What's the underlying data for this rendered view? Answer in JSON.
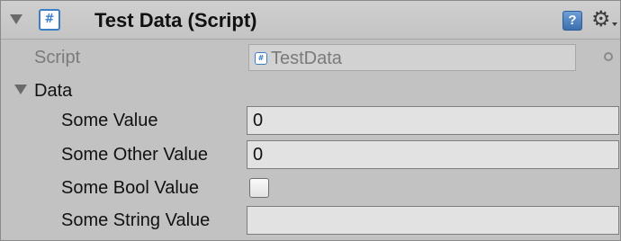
{
  "component": {
    "title": "Test Data (Script)",
    "icon": "csharp-script-icon",
    "help_icon_glyph": "?",
    "gear_icon_glyph": "⚙"
  },
  "script_row": {
    "label": "Script",
    "value": "TestData"
  },
  "data_section": {
    "label": "Data",
    "fields": [
      {
        "label": "Some Value",
        "value": "0"
      },
      {
        "label": "Some Other Value",
        "value": "0"
      },
      {
        "label": "Some Bool Value",
        "checked": false
      },
      {
        "label": "Some String Value",
        "value": ""
      }
    ]
  },
  "colors": {
    "panel_bg": "#c2c2c2",
    "field_bg": "#e2e2e2",
    "script_icon_blue": "#3d7fc6"
  }
}
